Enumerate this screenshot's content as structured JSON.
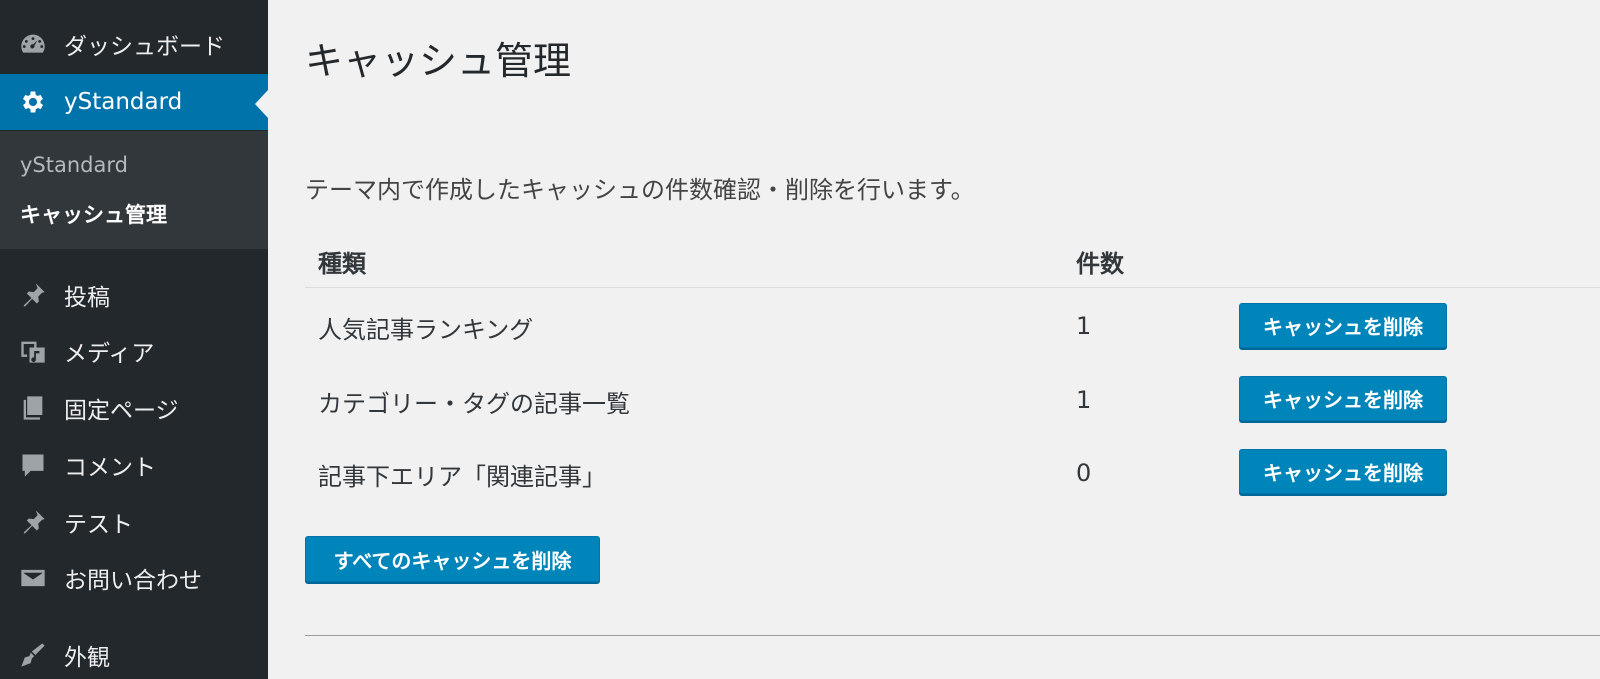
{
  "sidebar": {
    "items": [
      {
        "label": "ダッシュボード",
        "icon": "dashboard-icon"
      },
      {
        "label": "yStandard",
        "icon": "gear-icon"
      },
      {
        "label": "投稿",
        "icon": "pin-icon"
      },
      {
        "label": "メディア",
        "icon": "media-icon"
      },
      {
        "label": "固定ページ",
        "icon": "pages-icon"
      },
      {
        "label": "コメント",
        "icon": "comment-icon"
      },
      {
        "label": "テスト",
        "icon": "pin-icon"
      },
      {
        "label": "お問い合わせ",
        "icon": "mail-icon"
      },
      {
        "label": "外観",
        "icon": "appearance-icon"
      }
    ],
    "submenu": {
      "title": "yStandard",
      "current": "キャッシュ管理"
    },
    "active_color": "#0073aa"
  },
  "main": {
    "title": "キャッシュ管理",
    "description": "テーマ内で作成したキャッシュの件数確認・削除を行います。",
    "table": {
      "headers": [
        "種類",
        "件数"
      ],
      "rows": [
        {
          "type": "人気記事ランキング",
          "count": "1",
          "button": "キャッシュを削除"
        },
        {
          "type": "カテゴリー・タグの記事一覧",
          "count": "1",
          "button": "キャッシュを削除"
        },
        {
          "type": "記事下エリア「関連記事」",
          "count": "0",
          "button": "キャッシュを削除"
        }
      ]
    },
    "delete_all_label": "すべてのキャッシュを削除",
    "button_color": "#0085ba"
  }
}
